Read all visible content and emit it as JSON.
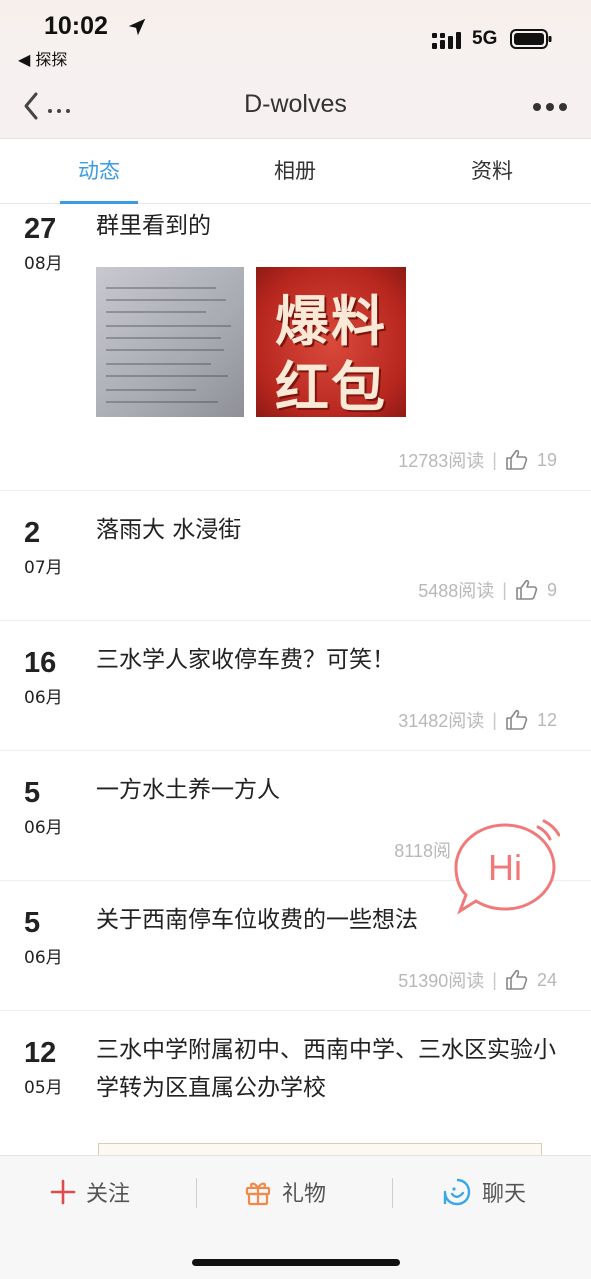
{
  "status_bar": {
    "time": "10:02",
    "back_app": "◀ 探探",
    "network": "5G",
    "icons": [
      "location-arrow-icon",
      "signal-icon",
      "battery-icon"
    ]
  },
  "nav": {
    "back_label": "‹...",
    "title": "D-wolves",
    "more_label": "more-dots-icon"
  },
  "tabs": [
    {
      "label": "动态",
      "active": true
    },
    {
      "label": "相册",
      "active": false
    },
    {
      "label": "资料",
      "active": false
    }
  ],
  "posts": [
    {
      "day": "27",
      "month": "08月",
      "title": "群里看到的",
      "images": [
        "document-photo",
        "爆料红包"
      ],
      "reads": "12783阅读",
      "likes": "19"
    },
    {
      "day": "2",
      "month": "07月",
      "title": "落雨大 水浸街",
      "reads": "5488阅读",
      "likes": "9"
    },
    {
      "day": "16",
      "month": "06月",
      "title": "三水学人家收停车费？可笑！",
      "reads": "31482阅读",
      "likes": "12"
    },
    {
      "day": "5",
      "month": "06月",
      "title": "一方水土养一方人",
      "reads": "8118阅",
      "likes": ""
    },
    {
      "day": "5",
      "month": "06月",
      "title": "关于西南停车位收费的一些想法",
      "reads": "51390阅读",
      "likes": "24"
    },
    {
      "day": "12",
      "month": "05月",
      "title": "三水中学附属初中、西南中学、三水区实验小学转为区直属公办学校"
    }
  ],
  "promo_image": {
    "line1": "爆料",
    "line2": "红包"
  },
  "hi_bubble": {
    "label": "Hi"
  },
  "bottom_bar": {
    "follow": "关注",
    "gift": "礼物",
    "chat": "聊天"
  },
  "colors": {
    "accent": "#3a9de0",
    "follow_red": "#e04a4a",
    "gift_orange": "#f08a4b",
    "chat_blue": "#3aa7e8",
    "hi_pink": "#f07a7a"
  }
}
